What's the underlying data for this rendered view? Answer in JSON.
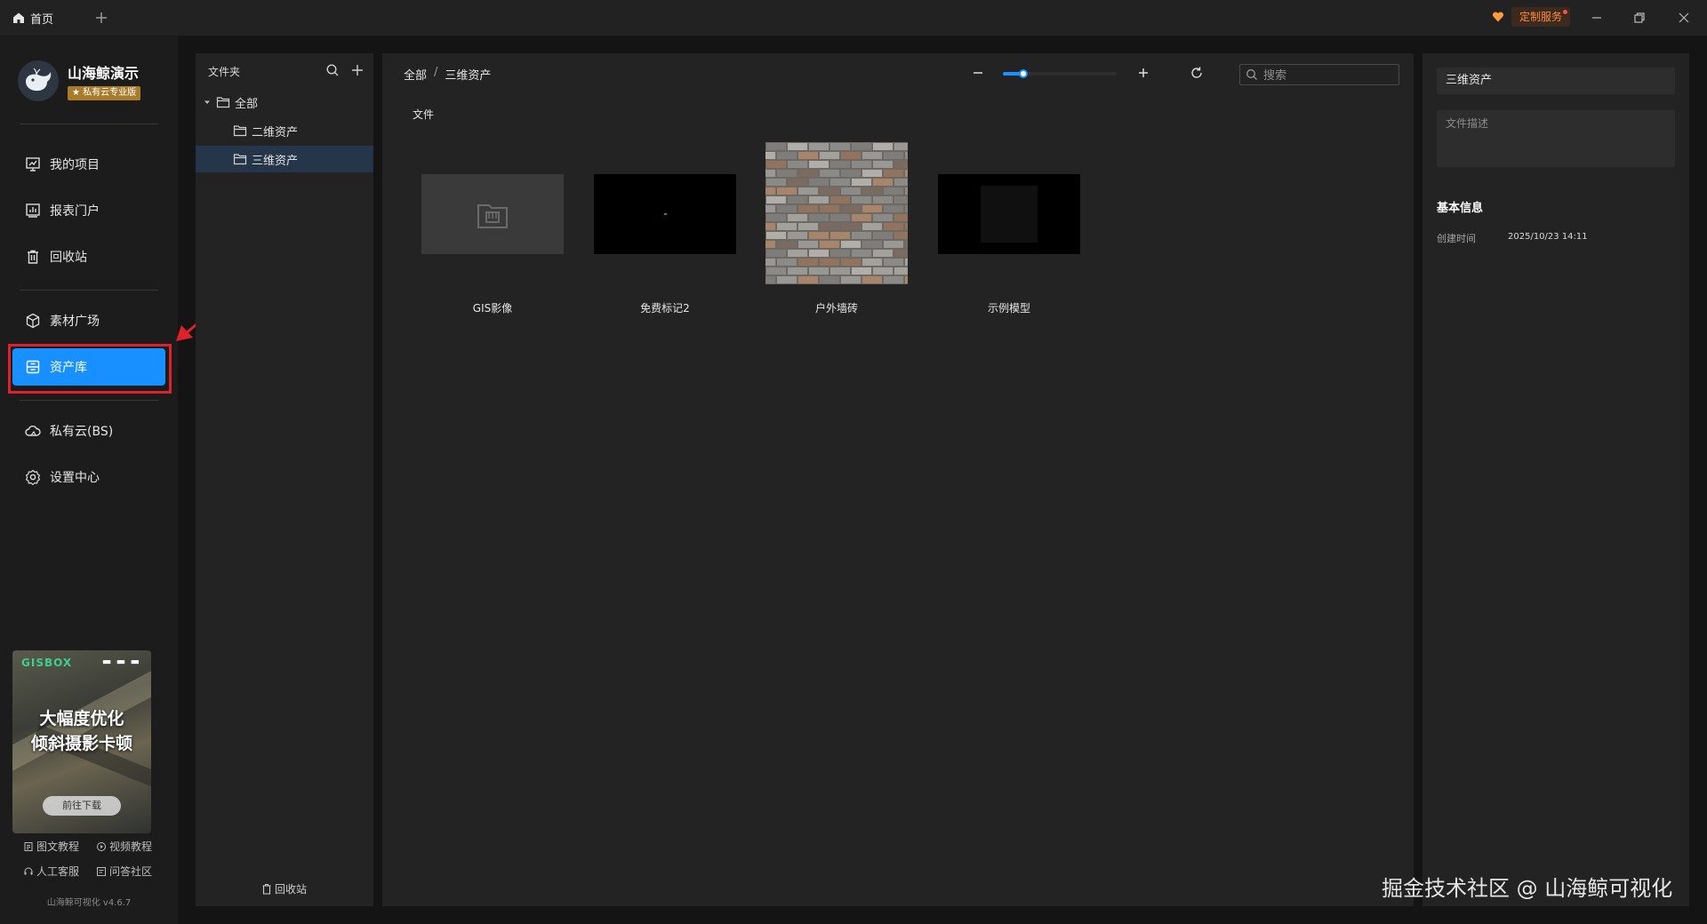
{
  "topbar": {
    "home_tab": "首页",
    "service_label": "定制服务"
  },
  "sidebar": {
    "brand_name": "山海鲸演示",
    "brand_badge": "★ 私有云专业版",
    "nav": [
      {
        "label": "我的项目",
        "icon": "chart-board-icon"
      },
      {
        "label": "报表门户",
        "icon": "bar-chart-icon"
      },
      {
        "label": "回收站",
        "icon": "trash-icon"
      },
      {
        "label": "素材广场",
        "icon": "cube-icon"
      },
      {
        "label": "资产库",
        "icon": "archive-icon",
        "active": true
      },
      {
        "label": "私有云(BS)",
        "icon": "cloud-icon"
      },
      {
        "label": "设置中心",
        "icon": "gear-icon"
      }
    ],
    "promo": {
      "logo": "GISBOX",
      "title_line1": "大幅度优化",
      "title_line2": "倾斜摄影卡顿",
      "button": "前往下载"
    },
    "help": {
      "doc": "图文教程",
      "video": "视频教程",
      "support": "人工客服",
      "community": "问答社区"
    },
    "version": "山海鲸可视化 v4.6.7"
  },
  "folders": {
    "title": "文件夹",
    "tree": [
      {
        "label": "全部",
        "level": 0,
        "expanded": true
      },
      {
        "label": "二维资产",
        "level": 1
      },
      {
        "label": "三维资产",
        "level": 1,
        "selected": true
      }
    ],
    "recycle": "回收站"
  },
  "main": {
    "breadcrumb": {
      "root": "全部",
      "sep": "/",
      "current": "三维资产"
    },
    "zoom_level": 0.18,
    "search_placeholder": "搜索",
    "section_label": "文件",
    "files": [
      {
        "name": "GIS影像",
        "thumb": "folder-placeholder"
      },
      {
        "name": "免费标记2",
        "thumb": "dark-preview"
      },
      {
        "name": "户外墙砖",
        "thumb": "brick-texture"
      },
      {
        "name": "示例模型",
        "thumb": "dark-preview"
      }
    ]
  },
  "details": {
    "name": "三维资产",
    "desc_placeholder": "文件描述",
    "section": "基本信息",
    "created_label": "创建时间",
    "created_value": "2025/10/23 14:11"
  },
  "watermark": "掘金技术社区 @ 山海鲸可视化",
  "colors": {
    "accent": "#1890ff",
    "highlight": "#e0202a",
    "service": "#ff8a3d"
  }
}
